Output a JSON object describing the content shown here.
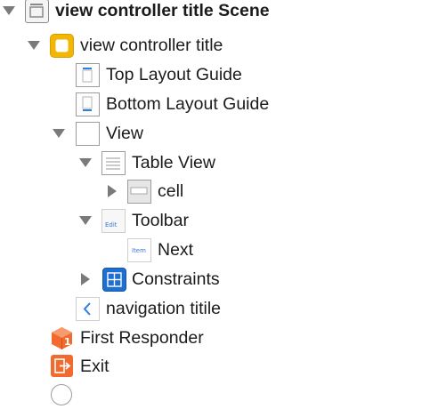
{
  "outline": {
    "scene": {
      "label": "view controller title Scene",
      "icon": "storyboard-scene-icon"
    },
    "view_controller": {
      "label": "view controller title",
      "icon": "view-controller-icon"
    },
    "top_layout_guide": {
      "label": "Top Layout Guide",
      "icon": "layout-guide-icon"
    },
    "bottom_layout_guide": {
      "label": "Bottom Layout Guide",
      "icon": "layout-guide-icon"
    },
    "view": {
      "label": "View",
      "icon": "view-icon"
    },
    "table_view": {
      "label": "Table View",
      "icon": "table-view-icon"
    },
    "cell": {
      "label": "cell",
      "icon": "table-cell-icon"
    },
    "toolbar": {
      "label": "Toolbar",
      "icon": "toolbar-icon",
      "icon_text": "Edit"
    },
    "next_item": {
      "label": "Next",
      "icon": "bar-button-item-icon",
      "icon_text": "Item"
    },
    "constraints": {
      "label": "Constraints",
      "icon": "constraints-icon"
    },
    "navigation_item": {
      "label": "navigation titile",
      "icon": "navigation-item-icon"
    },
    "first_responder": {
      "label": "First Responder",
      "icon": "first-responder-icon",
      "icon_text": "1"
    },
    "exit": {
      "label": "Exit",
      "icon": "exit-icon"
    }
  },
  "colors": {
    "disclosure_triangle": "#7a7a7a",
    "view_controller_icon": "#f2b705",
    "constraints_icon": "#1f6fd1",
    "first_responder_icon": "#f26a2e",
    "exit_icon": "#f26a2e"
  }
}
